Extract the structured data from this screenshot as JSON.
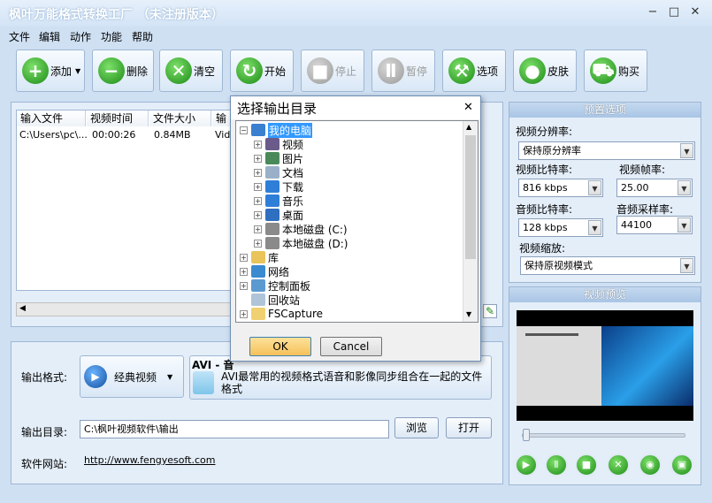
{
  "window": {
    "title": "枫叶万能格式转换工厂 （未注册版本）"
  },
  "menu": [
    "文件",
    "编辑",
    "动作",
    "功能",
    "帮助"
  ],
  "toolbar": {
    "add": "添加",
    "delete": "删除",
    "clear": "清空",
    "start": "开始",
    "stop": "停止",
    "pause": "暂停",
    "options": "选项",
    "skin": "皮肤",
    "buy": "购买"
  },
  "filelist": {
    "columns": [
      "输入文件",
      "视频时间",
      "文件大小",
      "输出"
    ],
    "rows": [
      {
        "file": "C:\\Users\\pc\\...",
        "time": "00:00:26",
        "size": "0.84MB",
        "out": "Vid"
      }
    ]
  },
  "output": {
    "format_label": "输出格式:",
    "format_button": "经典视频",
    "format_name": "AVI - 音",
    "format_desc": "AVI最常用的视频格式语音和影像同步组合在一起的文件格式",
    "dir_label": "输出目录:",
    "dir_value": "C:\\枫叶视频软件\\输出",
    "browse": "浏览",
    "open": "打开",
    "site_label": "软件网站:",
    "site_url": "http://www.fengyesoft.com"
  },
  "preset": {
    "title": "预置选项",
    "res_label": "视频分辨率:",
    "res_value": "保持原分辨率",
    "vbitrate_label": "视频比特率:",
    "vbitrate_value": "816 kbps",
    "fps_label": "视频帧率:",
    "fps_value": "25.00",
    "abitrate_label": "音频比特率:",
    "abitrate_value": "128 kbps",
    "asample_label": "音频采样率:",
    "asample_value": "44100",
    "scale_label": "视频缩放:",
    "scale_value": "保持原视频模式"
  },
  "preview": {
    "title": "视频预览"
  },
  "dialog": {
    "title": "选择输出目录",
    "ok": "OK",
    "cancel": "Cancel",
    "tree": [
      {
        "label": "我的电脑",
        "level": 0,
        "exp": "−",
        "color": "#3a7fd0",
        "selected": true
      },
      {
        "label": "视频",
        "level": 1,
        "exp": "+",
        "color": "#6b5b8a"
      },
      {
        "label": "图片",
        "level": 1,
        "exp": "+",
        "color": "#4a8a5a"
      },
      {
        "label": "文档",
        "level": 1,
        "exp": "+",
        "color": "#9ab0c8"
      },
      {
        "label": "下载",
        "level": 1,
        "exp": "+",
        "color": "#2f7fd8"
      },
      {
        "label": "音乐",
        "level": 1,
        "exp": "+",
        "color": "#2f7fd8"
      },
      {
        "label": "桌面",
        "level": 1,
        "exp": "+",
        "color": "#2f6fc0"
      },
      {
        "label": "本地磁盘 (C:)",
        "level": 1,
        "exp": "+",
        "color": "#8a8a8a"
      },
      {
        "label": "本地磁盘 (D:)",
        "level": 1,
        "exp": "+",
        "color": "#8a8a8a"
      },
      {
        "label": "库",
        "level": 0,
        "exp": "+",
        "color": "#e8c45a"
      },
      {
        "label": "网络",
        "level": 0,
        "exp": "+",
        "color": "#3a8ad0"
      },
      {
        "label": "控制面板",
        "level": 0,
        "exp": "+",
        "color": "#5a9ad0"
      },
      {
        "label": "回收站",
        "level": 0,
        "exp": "",
        "color": "#b0c4d8"
      },
      {
        "label": "FSCapture",
        "level": 0,
        "exp": "+",
        "color": "#f0d070"
      }
    ]
  }
}
